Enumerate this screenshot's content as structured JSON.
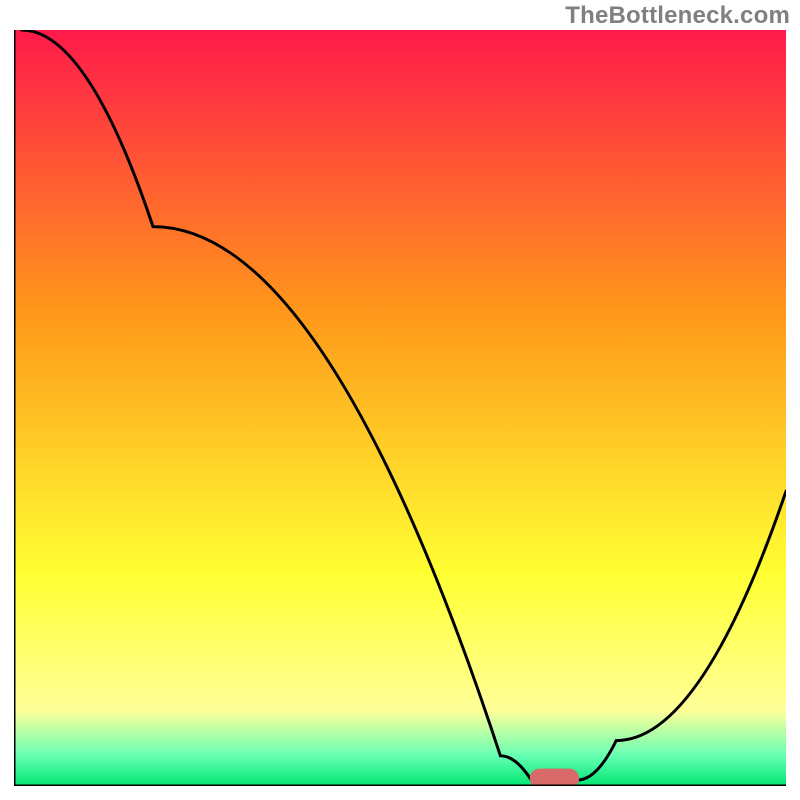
{
  "watermark": "TheBottleneck.com",
  "colors": {
    "red": "#ff1a4b",
    "orange": "#ff9a1a",
    "yellow": "#ffff33",
    "paleyellow": "#ffff99",
    "mint": "#66ffb3",
    "green": "#00e673",
    "curve": "#000000",
    "marker_fill": "#d86a6a",
    "axis": "#000000"
  },
  "chart_data": {
    "type": "line",
    "title": "",
    "xlabel": "",
    "ylabel": "",
    "xlim": [
      0,
      100
    ],
    "ylim": [
      0,
      100
    ],
    "curve": [
      {
        "x": 1,
        "y": 100
      },
      {
        "x": 18,
        "y": 74
      },
      {
        "x": 63,
        "y": 4
      },
      {
        "x": 67,
        "y": 0.8
      },
      {
        "x": 73,
        "y": 0.8
      },
      {
        "x": 78,
        "y": 6
      },
      {
        "x": 100,
        "y": 39
      }
    ],
    "marker": {
      "x": 70,
      "y": 1.0,
      "rx": 3.2,
      "ry": 1.3
    },
    "gradient_stops": [
      {
        "pct": 0,
        "color_key": "red"
      },
      {
        "pct": 38,
        "color_key": "orange"
      },
      {
        "pct": 72,
        "color_key": "yellow"
      },
      {
        "pct": 90,
        "color_key": "paleyellow"
      },
      {
        "pct": 96,
        "color_key": "mint"
      },
      {
        "pct": 100,
        "color_key": "green"
      }
    ]
  }
}
